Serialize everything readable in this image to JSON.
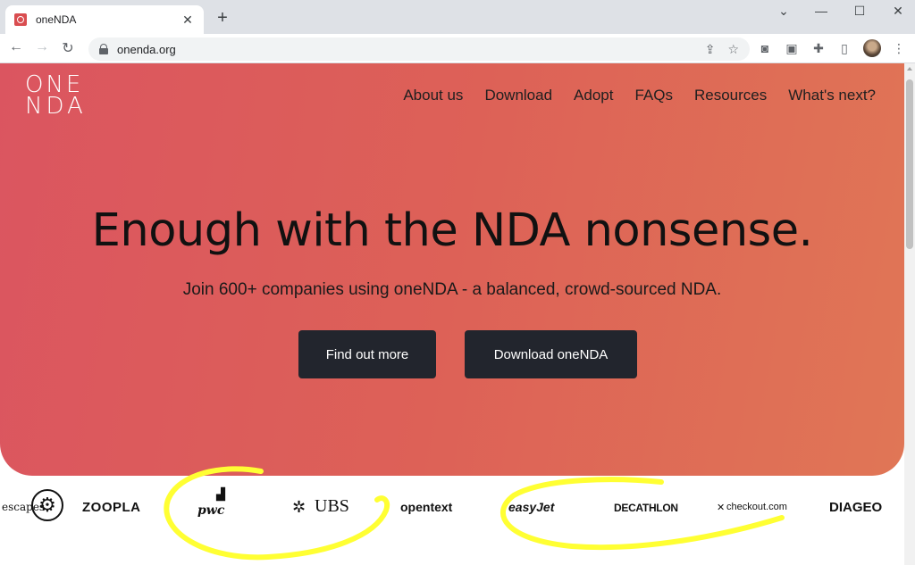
{
  "browser": {
    "tab_title": "oneNDA",
    "url": "onenda.org"
  },
  "site": {
    "logo_line1": "ONE",
    "logo_line2": "NDA",
    "nav": [
      "About us",
      "Download",
      "Adopt",
      "FAQs",
      "Resources",
      "What's next?"
    ]
  },
  "hero": {
    "headline": "Enough with the NDA nonsense.",
    "subline": "Join 600+ companies using oneNDA - a balanced, crowd-sourced NDA.",
    "button_primary": "Find out more",
    "button_secondary": "Download oneNDA"
  },
  "companies": [
    "escapes",
    "ZOOPLA",
    "pwc",
    "UBS",
    "opentext",
    "easyJet",
    "DECATHLON",
    "checkout.com",
    "DIAGEO"
  ],
  "colors": {
    "hero_start": "#db5560",
    "hero_end": "#e07656",
    "button": "#22252d",
    "annotation": "#ffff33"
  }
}
